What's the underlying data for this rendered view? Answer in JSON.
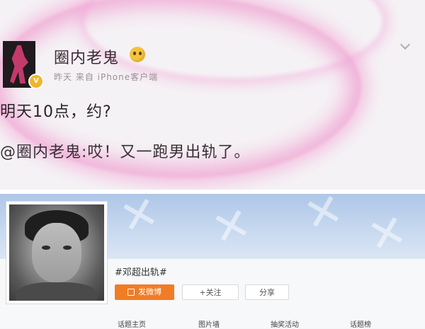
{
  "post": {
    "username": "圈内老鬼",
    "meta": "昨天  来自 iPhone客户端",
    "text": "明天10点，约?",
    "repost_text": "@圈内老鬼:哎！又一跑男出轨了。",
    "icons": [
      "verified-badge-icon",
      "emoji-icon",
      "chevron-down-icon"
    ]
  },
  "topic": {
    "title": "#邓超出轨#",
    "buttons": {
      "post_label": "发微博",
      "follow_label": "+关注",
      "share_label": "分享"
    },
    "tabs": [
      {
        "label": "话题主页"
      },
      {
        "label": "图片墙"
      },
      {
        "label": "抽奖活动"
      },
      {
        "label": "话题榜"
      }
    ]
  },
  "colors": {
    "glow": "#e978be",
    "primary_button": "#f07d26",
    "banner": "#aec6e8"
  }
}
